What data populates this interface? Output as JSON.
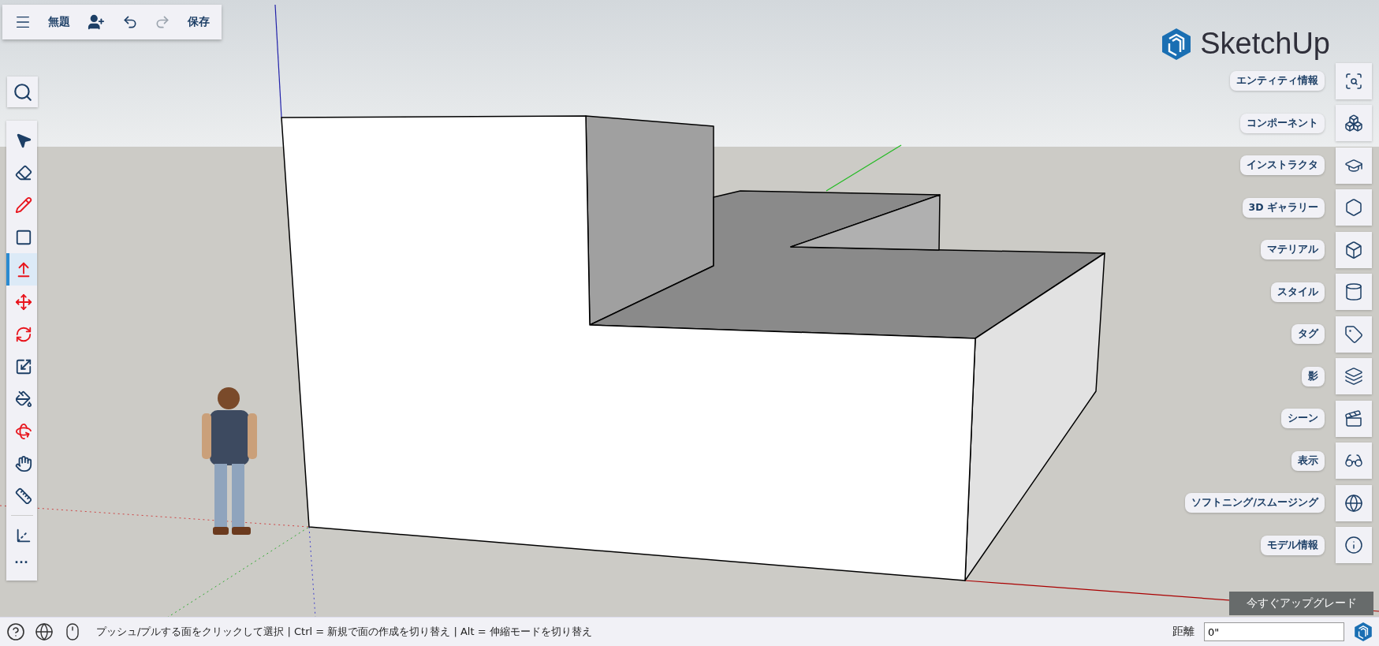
{
  "top_bar": {
    "title": "無題",
    "undo": {
      "disabled": false
    },
    "redo": {
      "disabled": true
    },
    "save": "保存"
  },
  "tools": [
    {
      "kind": "select",
      "selected": false
    },
    {
      "kind": "eraser",
      "selected": false
    },
    {
      "kind": "pencil",
      "selected": false
    },
    {
      "kind": "rectangle",
      "selected": false
    },
    {
      "kind": "pushpull",
      "selected": true
    },
    {
      "kind": "move",
      "selected": false
    },
    {
      "kind": "rotate",
      "selected": false
    },
    {
      "kind": "scale",
      "selected": false
    },
    {
      "kind": "paint",
      "selected": false
    },
    {
      "kind": "orbit",
      "selected": false
    },
    {
      "kind": "pan",
      "selected": false
    },
    {
      "kind": "tape",
      "selected": false
    },
    {
      "kind": "axes",
      "selected": false
    }
  ],
  "more_tools": "···",
  "logo": "SketchUp",
  "panels": [
    {
      "kind": "entity",
      "label": "エンティティ情報"
    },
    {
      "kind": "components",
      "label": "コンポーネント"
    },
    {
      "kind": "instructor",
      "label": "インストラクタ"
    },
    {
      "kind": "gallery",
      "label": "3D ギャラリー"
    },
    {
      "kind": "materials",
      "label": "マテリアル"
    },
    {
      "kind": "styles",
      "label": "スタイル"
    },
    {
      "kind": "tags",
      "label": "タグ"
    },
    {
      "kind": "shadows",
      "label": "影"
    },
    {
      "kind": "scenes",
      "label": "シーン"
    },
    {
      "kind": "display",
      "label": "表示"
    },
    {
      "kind": "soften",
      "label": "ソフトニング/スムージング"
    },
    {
      "kind": "info",
      "label": "モデル情報"
    }
  ],
  "upgrade": "今すぐアップグレード",
  "status_bar": {
    "hint": "プッシュ/プルする面をクリックして選択 | Ctrl = 新規で面の作成を切り替え | Alt = 伸縮モードを切り替え",
    "measure_label": "距離",
    "measure_value": "0\""
  }
}
